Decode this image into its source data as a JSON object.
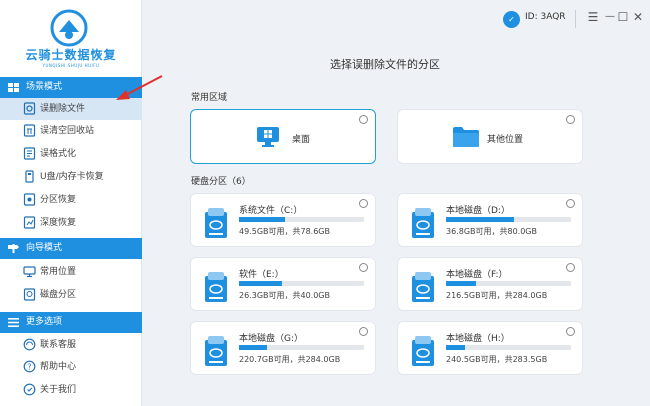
{
  "app": {
    "name": "云骑士数据恢复",
    "subtitle": "YUNQISHI SHUJU HUIFU",
    "user_id": "ID: 3AQR"
  },
  "window_controls": {
    "menu": "☰",
    "minimize": "—",
    "maximize": "☐",
    "close": "✕"
  },
  "sidebar": {
    "sections": [
      {
        "title": "场景模式",
        "icon": "grid-icon",
        "items": [
          {
            "label": "误删除文件",
            "icon": "file-restore-icon",
            "active": true
          },
          {
            "label": "误清空回收站",
            "icon": "recycle-bin-icon"
          },
          {
            "label": "误格式化",
            "icon": "format-icon"
          },
          {
            "label": "U盘/内存卡恢复",
            "icon": "usb-icon"
          },
          {
            "label": "分区恢复",
            "icon": "partition-icon"
          },
          {
            "label": "深度恢复",
            "icon": "deep-scan-icon"
          }
        ]
      },
      {
        "title": "向导模式",
        "icon": "signpost-icon",
        "items": [
          {
            "label": "常用位置",
            "icon": "monitor-icon"
          },
          {
            "label": "磁盘分区",
            "icon": "disk-icon"
          }
        ]
      },
      {
        "title": "更多选项",
        "icon": "menu-icon",
        "items": [
          {
            "label": "联系客服",
            "icon": "headset-icon"
          },
          {
            "label": "帮助中心",
            "icon": "help-icon"
          },
          {
            "label": "关于我们",
            "icon": "info-icon"
          }
        ]
      }
    ]
  },
  "main": {
    "title": "选择误删除文件的分区",
    "common_label": "常用区域",
    "common": [
      {
        "label": "桌面",
        "icon": "windows-icon",
        "selected": true
      },
      {
        "label": "其他位置",
        "icon": "folder-icon",
        "selected": false
      }
    ],
    "disks_label": "硬盘分区（6）",
    "drives": [
      {
        "name": "系统文件（C:）",
        "info": "49.5GB可用，共78.6GB",
        "used_fraction": 0.37
      },
      {
        "name": "本地磁盘（D:）",
        "info": "36.8GB可用，共80.0GB",
        "used_fraction": 0.54
      },
      {
        "name": "软件（E:）",
        "info": "26.3GB可用，共40.0GB",
        "used_fraction": 0.34
      },
      {
        "name": "本地磁盘（F:）",
        "info": "216.5GB可用，共284.0GB",
        "used_fraction": 0.24
      },
      {
        "name": "本地磁盘（G:）",
        "info": "220.7GB可用，共284.0GB",
        "used_fraction": 0.22
      },
      {
        "name": "本地磁盘（H:）",
        "info": "240.5GB可用，共283.5GB",
        "used_fraction": 0.15
      }
    ]
  },
  "colors": {
    "accent": "#1f8fe0",
    "active_bg": "#d6e6f5",
    "annotation_arrow": "#e0312b"
  }
}
